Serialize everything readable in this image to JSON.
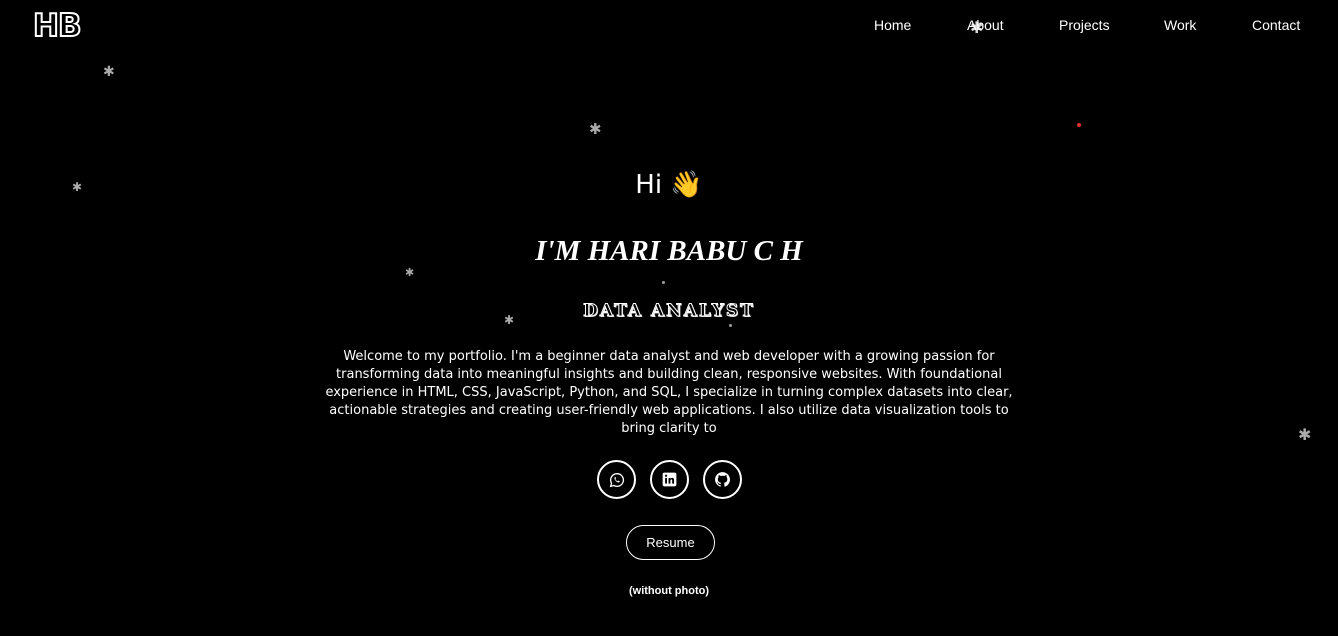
{
  "brand": {
    "logo_text": "HB"
  },
  "nav": {
    "items": [
      {
        "label": "Home"
      },
      {
        "label": "About"
      },
      {
        "label": "Projects"
      },
      {
        "label": "Work"
      },
      {
        "label": "Contact"
      }
    ]
  },
  "hero": {
    "greeting": "Hi 👋",
    "name": "I'M HARI BABU C H",
    "role": "DATA ANALYST",
    "intro": "Welcome to my portfolio. I'm a beginner data analyst and web developer with a growing passion for transforming data into meaningful insights and building clean, responsive websites. With foundational experience in HTML, CSS, JavaScript, Python, and SQL, I specialize in turning complex datasets into clear, actionable strategies and creating user-friendly web applications. I also utilize data visualization tools to bring clarity to"
  },
  "social": {
    "icons": [
      "whatsapp-icon",
      "linkedin-icon",
      "github-icon"
    ]
  },
  "actions": {
    "resume_label": "Resume",
    "note": "(without photo)"
  },
  "colors": {
    "background": "#000000",
    "text": "#ffffff",
    "star": "#aaaaaa",
    "accent_dot": "#e03030"
  }
}
